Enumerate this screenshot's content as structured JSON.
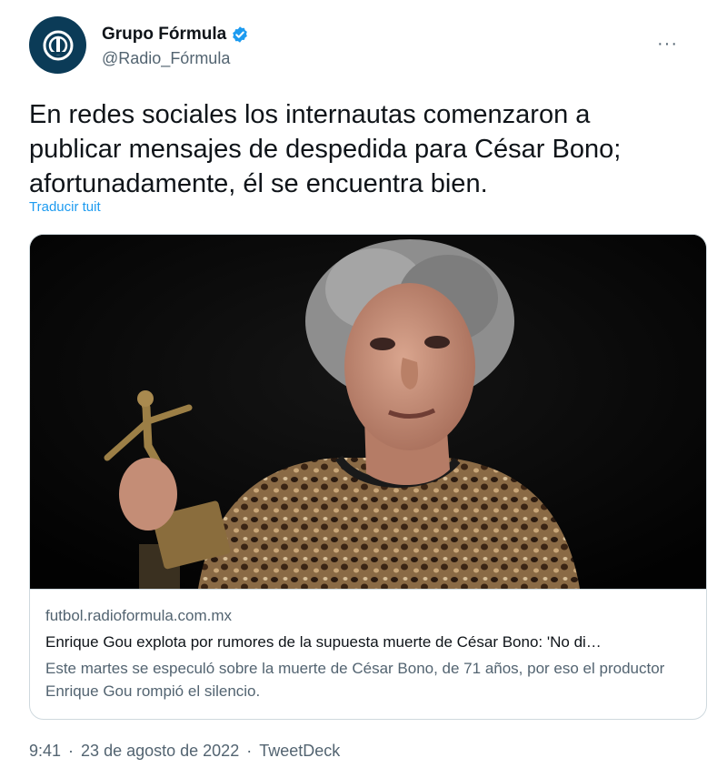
{
  "account": {
    "display_name": "Grupo Fórmula",
    "handle": "@Radio_Fórmula",
    "verified": true,
    "avatar_color": "#0b3b57"
  },
  "menu": {
    "more_label": "···"
  },
  "tweet": {
    "text": "En redes sociales los internautas comenzaron a publicar mensajes de despedida para César Bono; afortunadamente, él se encuentra bien.",
    "translate_label": "Traducir tuit"
  },
  "card": {
    "domain": "futbol.radioformula.com.mx",
    "title": "Enrique Gou explota por rumores de la supuesta muerte de César Bono: 'No di…",
    "description": "Este martes se especuló sobre la muerte de César Bono, de 71 años, por eso el productor Enrique Gou rompió el silencio."
  },
  "meta": {
    "time": "9:41",
    "dot": "·",
    "date": "23 de agosto de 2022",
    "source": "TweetDeck"
  },
  "colors": {
    "link_blue": "#1d9bf0",
    "secondary_text": "#536471",
    "border": "#cfd9de"
  }
}
